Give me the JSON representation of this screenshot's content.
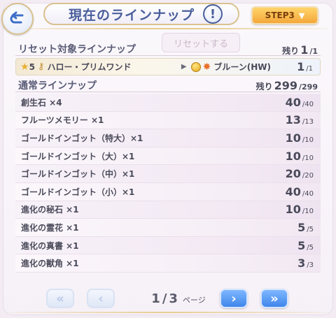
{
  "header": {
    "title": "現在のラインナップ",
    "help_label": "!",
    "step_label": "STEP3"
  },
  "reset_button_label": "リセットする",
  "reset_section": {
    "heading": "リセット対象ラインナップ",
    "remain_label": "残り",
    "remain_value": "1",
    "remain_total": "/1",
    "item": {
      "rarity": "5",
      "name": "ハロー・プリムワンド",
      "target": "ブルーン(HW)",
      "count": "1",
      "total": "/1"
    }
  },
  "normal_section": {
    "heading": "通常ラインナップ",
    "remain_label": "残り",
    "remain_value": "299",
    "remain_total": "/299",
    "items": [
      {
        "name": "創生石 ×4",
        "count": "40",
        "total": "/40"
      },
      {
        "name": "フルーツメモリー ×1",
        "count": "13",
        "total": "/13"
      },
      {
        "name": "ゴールドインゴット（特大）×1",
        "count": "10",
        "total": "/10"
      },
      {
        "name": "ゴールドインゴット（大）×1",
        "count": "10",
        "total": "/10"
      },
      {
        "name": "ゴールドインゴット（中）×1",
        "count": "20",
        "total": "/20"
      },
      {
        "name": "ゴールドインゴット（小）×1",
        "count": "40",
        "total": "/40"
      },
      {
        "name": "進化の秘石 ×1",
        "count": "10",
        "total": "/10"
      },
      {
        "name": "進化の霊花 ×1",
        "count": "5",
        "total": "/5"
      },
      {
        "name": "進化の真書 ×1",
        "count": "5",
        "total": "/5"
      },
      {
        "name": "進化の獣角 ×1",
        "count": "3",
        "total": "/3"
      }
    ]
  },
  "pager": {
    "current": "1",
    "separator": "/",
    "total": "3",
    "label": "ページ",
    "first_icon": "double-chevron-left-icon",
    "prev_icon": "chevron-left-icon",
    "next_icon": "chevron-right-icon",
    "last_icon": "double-chevron-right-icon"
  }
}
